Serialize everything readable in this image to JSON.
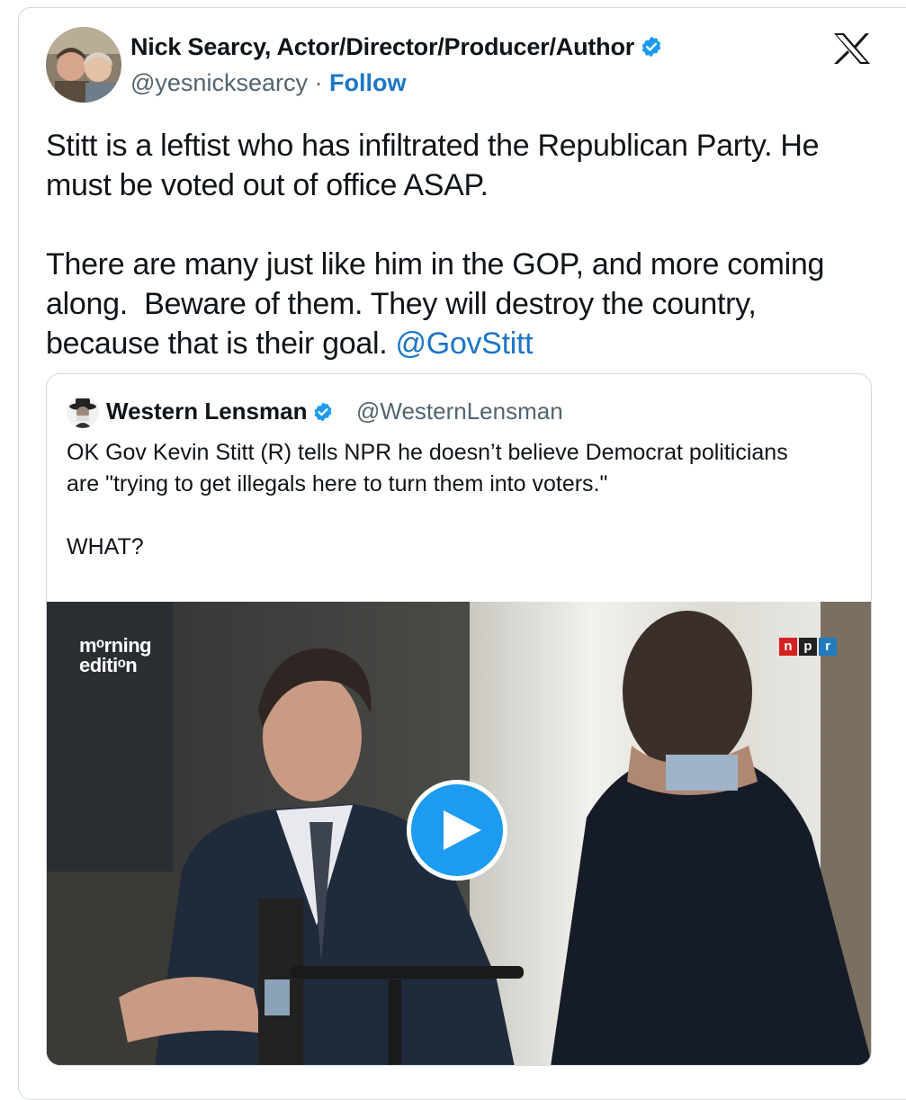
{
  "tweet": {
    "author_name": "Nick Searcy, Actor/Director/Producer/Author",
    "author_handle": "@yesnicksearcy",
    "separator": " · ",
    "follow_label": "Follow",
    "text_main": "Stitt is a leftist who has infiltrated the Republican Party. He\nmust be voted out of office ASAP.\n\nThere are many just like him in the GOP, and more coming\nalong.  Beware of them. They will destroy the country,\nbecause that is their goal. ",
    "mention": "@GovStitt",
    "verified_icon": "verified-badge-icon",
    "platform_icon": "x-logo-icon"
  },
  "quote": {
    "author_name": "Western Lensman",
    "author_handle": "@WesternLensman",
    "text": "OK Gov Kevin Stitt (R) tells NPR he doesn’t believe Democrat politicians\nare \"trying to get illegals here to turn them into voters.\"\n\nWHAT?",
    "verified_icon": "verified-badge-icon"
  },
  "video": {
    "show_logo_line1": "mᵒrning",
    "show_logo_line2": "editiᵒn",
    "network_logo": [
      "n",
      "p",
      "r"
    ],
    "play_icon": "play-icon"
  },
  "colors": {
    "link": "#1d76c7",
    "verified": "#1d9bf0",
    "play_button": "#1d9bf0",
    "npr_red": "#d62021",
    "npr_black": "#222222",
    "npr_blue": "#237bbd"
  }
}
